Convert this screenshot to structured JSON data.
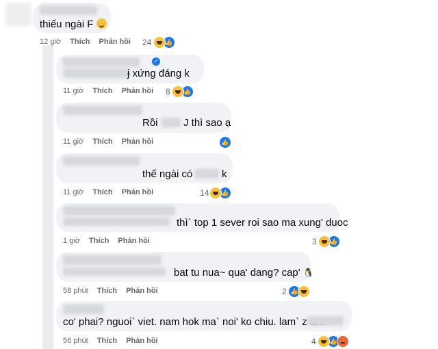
{
  "comments": [
    {
      "text": "thiếu ngài F",
      "emoji": "smile-emoji",
      "time": "12 giờ",
      "like_label": "Thích",
      "reply_label": "Phản hồi",
      "reaction_count": "24"
    },
    {
      "text": "ɉ xứng đáng k",
      "time": "11 giờ",
      "like_label": "Thích",
      "reply_label": "Phản hồi",
      "reaction_count": "8"
    },
    {
      "text_left": "Rồi",
      "text_right": "J thì sao ạ",
      "time": "11 giờ",
      "like_label": "Thích",
      "reply_label": "Phản hồi"
    },
    {
      "text_left": "thế ngài có",
      "text_right": "k",
      "time": "11 giờ",
      "like_label": "Thích",
      "reply_label": "Phản hồi",
      "reaction_count": "14"
    },
    {
      "text": "thì` top 1 sever roi sao ma xung' duoc",
      "time": "1 giờ",
      "like_label": "Thích",
      "reply_label": "Phản hồi",
      "reaction_count": "3"
    },
    {
      "text": "bat tu nua~ qua' dang? cap'",
      "emoji": "🐧",
      "time": "58 phút",
      "like_label": "Thích",
      "reply_label": "Phản hồi",
      "reaction_count": "2"
    },
    {
      "text": "co' phai? nguoi` viet. nam hok ma` noi' ko chiu. lam` z anh `",
      "time": "56 phút",
      "like_label": "Thích",
      "reply_label": "Phản hồi",
      "reaction_count": "4"
    }
  ],
  "icons": {
    "haha": "haha-reaction-icon",
    "like": "like-reaction-icon",
    "angry": "angry-reaction-icon",
    "verified": "verified-badge-icon"
  },
  "colors": {
    "bubble": "#f0f2f5",
    "meta_text": "#65676b",
    "like_blue": "#1877f2",
    "haha_yellow": "#f7c03a"
  }
}
